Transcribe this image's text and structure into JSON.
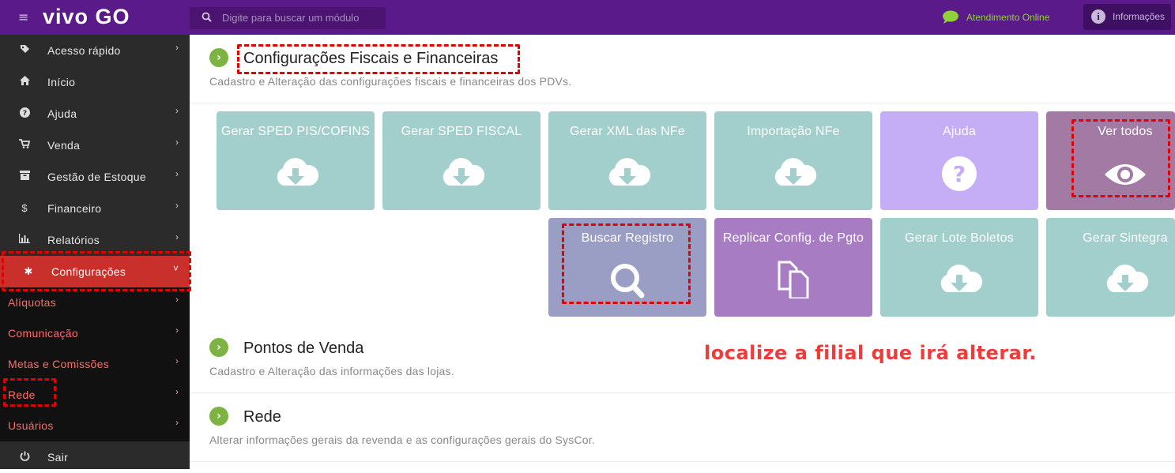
{
  "header": {
    "logo": "vivo GO",
    "search_placeholder": "Digite para buscar um módulo",
    "chat_label": "Atendimento Online",
    "info_label": "Informações"
  },
  "sidebar": {
    "items": [
      {
        "label": "Acesso rápido",
        "icon": "tag-icon",
        "chevron": "›"
      },
      {
        "label": "Início",
        "icon": "home-icon",
        "chevron": ""
      },
      {
        "label": "Ajuda",
        "icon": "question-icon",
        "chevron": "›"
      },
      {
        "label": "Venda",
        "icon": "cart-icon",
        "chevron": "›"
      },
      {
        "label": "Gestão de Estoque",
        "icon": "archive-icon",
        "chevron": "›"
      },
      {
        "label": "Financeiro",
        "icon": "dollar-icon",
        "chevron": "›"
      },
      {
        "label": "Relatórios",
        "icon": "bar-chart-icon",
        "chevron": "›"
      },
      {
        "label": "Configurações",
        "icon": "gear-icon",
        "chevron": "˅"
      }
    ],
    "subitems": [
      "Alíquotas",
      "Comunicação",
      "Metas e Comissões",
      "Rede",
      "Usuários"
    ],
    "logout": "Sair"
  },
  "main": {
    "section1": {
      "title": "Configurações Fiscais e Financeiras",
      "subtitle": "Cadastro e Alteração das configurações fiscais e financeiras dos PDVs."
    },
    "tiles": [
      {
        "label": "Gerar SPED PIS/COFINS",
        "icon": "cloud-download-icon"
      },
      {
        "label": "Gerar SPED FISCAL",
        "icon": "cloud-download-icon"
      },
      {
        "label": "Gerar XML das NFe",
        "icon": "cloud-download-icon"
      },
      {
        "label": "Importação NFe",
        "icon": "cloud-download-icon"
      },
      {
        "label": "Ajuda",
        "icon": "question-circle-icon"
      },
      {
        "label": "Ver todos",
        "icon": "eye-icon"
      },
      {
        "label": "Buscar Registro",
        "icon": "search-icon"
      },
      {
        "label": "Replicar Config. de Pgto",
        "icon": "copy-icon"
      },
      {
        "label": "Gerar Lote Boletos",
        "icon": "cloud-download-icon"
      },
      {
        "label": "Gerar Sintegra",
        "icon": "cloud-download-icon"
      }
    ],
    "section2": {
      "title": "Pontos de Venda",
      "subtitle": "Cadastro e Alteração das informações das lojas."
    },
    "section3": {
      "title": "Rede",
      "subtitle": "Alterar informações gerais da revenda e as configurações gerais do SysCor."
    },
    "annotation_note": "localize a filial que irá alterar."
  },
  "colors": {
    "topbar": "#5b1a8a",
    "sidebar": "#2b2b2b",
    "active": "#c9302c",
    "teal_tile": "#a2cfcb",
    "annotation": "#e00000"
  }
}
